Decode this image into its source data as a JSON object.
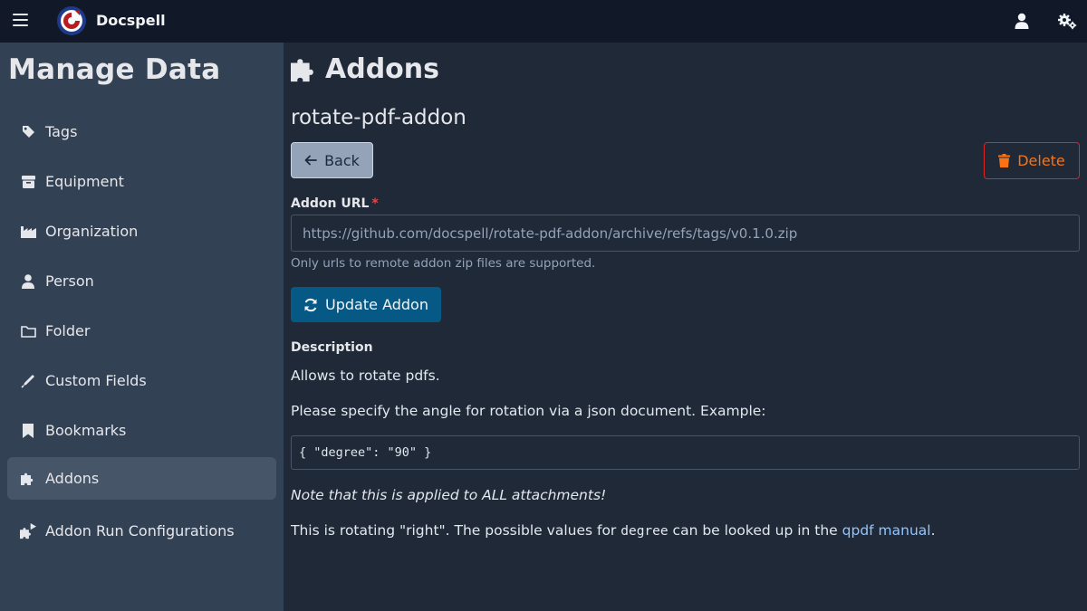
{
  "app": {
    "name": "Docspell"
  },
  "header": {
    "menu_icon": "hamburger-icon",
    "user_icon": "user-icon",
    "settings_icon": "cogs-icon"
  },
  "sidebar": {
    "title": "Manage Data",
    "items": [
      {
        "label": "Tags",
        "icon": "tag-icon"
      },
      {
        "label": "Equipment",
        "icon": "box-icon"
      },
      {
        "label": "Organization",
        "icon": "industry-icon"
      },
      {
        "label": "Person",
        "icon": "user-icon"
      },
      {
        "label": "Folder",
        "icon": "folder-icon"
      },
      {
        "label": "Custom Fields",
        "icon": "pen-icon"
      },
      {
        "label": "Bookmarks",
        "icon": "bookmark-icon"
      },
      {
        "label": "Addons",
        "icon": "puzzle-icon",
        "active": true
      },
      {
        "label": "Addon Run Configurations",
        "icon": "puzzle-play-icon"
      }
    ]
  },
  "main": {
    "title": "Addons",
    "addon_name": "rotate-pdf-addon",
    "back_label": "Back",
    "delete_label": "Delete",
    "url_label": "Addon URL",
    "url_required_mark": "*",
    "url_value": "https://github.com/docspell/rotate-pdf-addon/archive/refs/tags/v0.1.0.zip",
    "url_hint": "Only urls to remote addon zip files are supported.",
    "update_label": "Update Addon",
    "description_label": "Description",
    "desc_p1": "Allows to rotate pdfs.",
    "desc_p2": "Please specify the angle for rotation via a json document. Example:",
    "desc_code": "{ \"degree\": \"90\" }",
    "desc_p3": "Note that this is applied to ALL attachments!",
    "desc_p4_before": "This is rotating \"right\". The possible values for ",
    "desc_p4_code": "degree",
    "desc_p4_middle": " can be looked up in the ",
    "desc_p4_link": "qpdf manual",
    "desc_p4_after": "."
  },
  "colors": {
    "topbar_bg": "#111827",
    "sidebar_bg": "#334155",
    "main_bg": "#1f2937",
    "primary_button": "#075985",
    "delete_border": "#dc2626",
    "delete_text": "#f97316",
    "link": "#93c5fd"
  }
}
